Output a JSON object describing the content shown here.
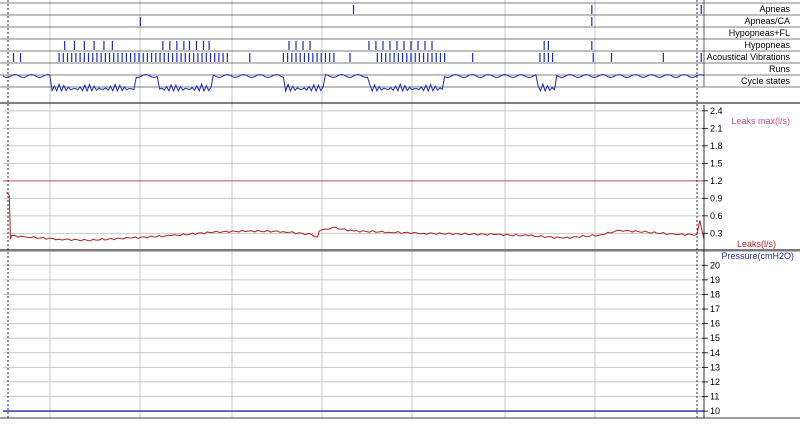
{
  "colors": {
    "event": "#1c2bb0",
    "leaks": "#b02020",
    "leaks_max": "#c8508c",
    "pressure": "#1c2bb0",
    "grid": "#c8c8c8",
    "divider": "#7a7a7a"
  },
  "chart_data": [
    {
      "type": "event-tracks",
      "x_range": [
        0,
        100
      ],
      "tracks": [
        {
          "label": "Apneas",
          "events": [
            50,
            84,
            99.6
          ]
        },
        {
          "label": "Apneas/CA",
          "events": [
            19.6,
            84
          ]
        },
        {
          "label": "Hypopneas+FL",
          "events": []
        },
        {
          "label": "Hypopneas",
          "events": [
            8.8,
            10.2,
            11.6,
            13,
            14.4,
            15.6,
            22.8,
            23.8,
            24.8,
            25.8,
            26.6,
            27.6,
            28.6,
            29.4,
            40.8,
            41.8,
            42.8,
            43.8,
            52.2,
            53.2,
            54.2,
            55.2,
            56.2,
            57.2,
            58.2,
            59.2,
            60.2,
            61.2,
            77.2,
            77.8,
            84
          ]
        },
        {
          "label": "Acoustical Vibrations",
          "events": [
            1.5,
            2.5,
            8,
            8.6,
            9.2,
            9.8,
            10.4,
            11,
            11.6,
            12.2,
            12.8,
            13.4,
            14,
            14.6,
            15.2,
            15.8,
            16.4,
            17,
            17.6,
            18.2,
            18.8,
            19.4,
            20,
            20.6,
            21.2,
            21.8,
            22.4,
            23,
            23.6,
            24.2,
            24.8,
            25.4,
            26,
            26.6,
            27.2,
            27.8,
            28.4,
            29,
            29.6,
            30.2,
            30.8,
            31.4,
            32,
            35.2,
            40,
            40.6,
            41.2,
            41.8,
            42.4,
            43,
            43.6,
            44.2,
            44.8,
            45.4,
            46,
            46.6,
            47.2,
            49.5,
            53.4,
            54,
            54.6,
            55.2,
            55.8,
            56.4,
            57,
            57.6,
            58.2,
            58.8,
            59.4,
            60,
            60.6,
            61.2,
            61.8,
            62.4,
            63,
            67,
            76.6,
            77.2,
            77.8,
            78.4,
            84.2,
            86.8,
            94.2,
            99.6
          ]
        },
        {
          "label": "Runs",
          "events": []
        },
        {
          "label": "Cycle states",
          "events": []
        }
      ]
    },
    {
      "type": "line",
      "series": [
        {
          "name": "Leaks(l/s)",
          "x": [
            0.5,
            0.9,
            1.05,
            1.2,
            3,
            8,
            12,
            18,
            24,
            30,
            35,
            40,
            44,
            44.9,
            45.1,
            47,
            50,
            55,
            60,
            65,
            70,
            75,
            80,
            85,
            88,
            92,
            96,
            99,
            99.4,
            99.8,
            100
          ],
          "y": [
            1,
            0.95,
            0.2,
            0.26,
            0.24,
            0.2,
            0.18,
            0.22,
            0.26,
            0.32,
            0.34,
            0.33,
            0.28,
            0.24,
            0.34,
            0.4,
            0.34,
            0.32,
            0.3,
            0.29,
            0.28,
            0.26,
            0.22,
            0.27,
            0.35,
            0.32,
            0.28,
            0.28,
            0.52,
            0.3,
            0.2
          ]
        },
        {
          "name": "Leaks max(l/s)",
          "x": [
            0,
            100
          ],
          "y": [
            1.2,
            1.2
          ]
        }
      ],
      "ylim": [
        0.1,
        2.5
      ],
      "yticks": [
        0.3,
        0.6,
        0.9,
        1.2,
        1.5,
        1.8,
        2.1,
        2.4
      ],
      "grid": true
    },
    {
      "type": "line",
      "series": [
        {
          "name": "Pressure(cmH2O)",
          "x": [
            0,
            100
          ],
          "y": [
            10,
            10
          ]
        }
      ],
      "ylim": [
        9.8,
        20.5
      ],
      "yticks": [
        10,
        11,
        12,
        13,
        14,
        15,
        16,
        17,
        18,
        19,
        20
      ],
      "grid": true
    }
  ]
}
